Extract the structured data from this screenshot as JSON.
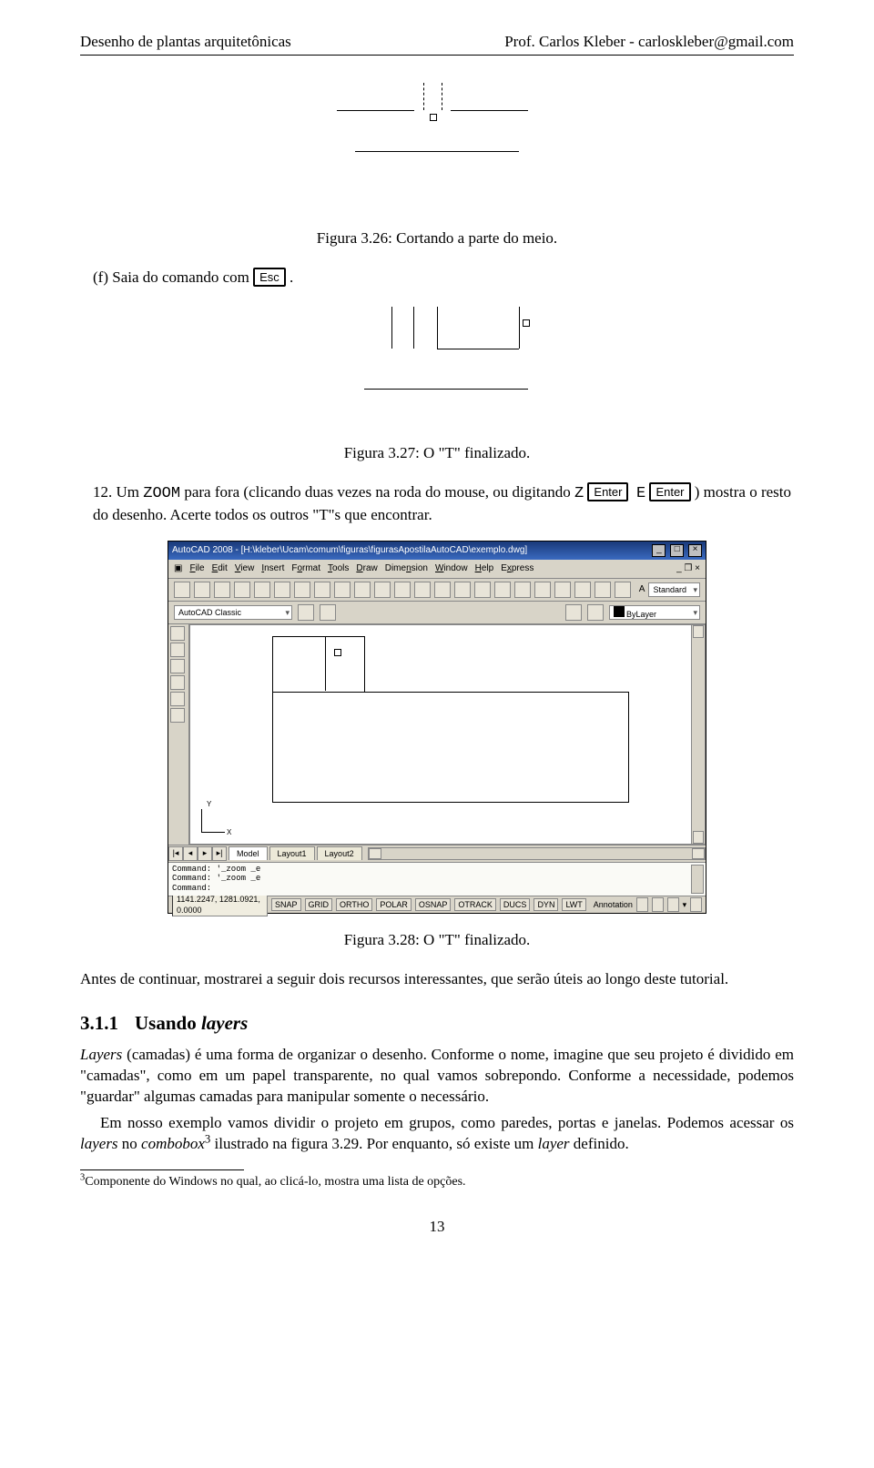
{
  "header": {
    "left": "Desenho de plantas arquitetônicas",
    "right": "Prof. Carlos Kleber - carloskleber@gmail.com"
  },
  "captions": {
    "fig326": "Figura 3.26: Cortando a parte do meio.",
    "fig327": "Figura 3.27: O \"T\" finalizado.",
    "fig328": "Figura 3.28: O \"T\" finalizado."
  },
  "list_f": {
    "label": "(f)",
    "text_before_key": "Saia do comando com ",
    "key": "Esc",
    "text_after_key": " ."
  },
  "list_12": {
    "label": "12.",
    "text_a": "Um ",
    "mono": "ZOOM",
    "text_b": " para fora (clicando duas vezes na roda do mouse, ou digitando ",
    "mono_z": "Z",
    "key1": "Enter",
    "mono_e": "E",
    "key2": "Enter",
    "text_c": " ) mostra o resto do desenho. Acerte todos os outros \"T\"s que encontrar."
  },
  "para_antes": "Antes de continuar, mostrarei a seguir dois recursos interessantes, que serão úteis ao longo deste tutorial.",
  "section": {
    "num": "3.1.1",
    "title": "Usando layers"
  },
  "para_layers_a": "Layers (camadas) é uma forma de organizar o desenho. Conforme o nome, imagine que seu projeto é dividido em \"camadas\", como em um papel transparente, no qual vamos sobrepondo. Conforme a necessidade, podemos \"guardar\" algumas camadas para manipular somente o necessário.",
  "para_layers_b_1": "Em nosso exemplo vamos dividir o projeto em grupos, como paredes, portas e janelas. Podemos acessar os ",
  "para_layers_b_2": " no ",
  "para_layers_b_3": " ilustrado na figura 3.29. Por enquanto, só existe um ",
  "para_layers_b_4": " definido.",
  "em_layers": "layers",
  "em_combobox": "combobox",
  "em_layer": "layer",
  "footnote_num": "3",
  "footnote_text": "Componente do Windows no qual, ao clicá-lo, mostra uma lista de opções.",
  "page_number": "13",
  "acad": {
    "title": "AutoCAD 2008 - [H:\\kleber\\Ucam\\comum\\figuras\\figurasApostilaAutoCAD\\exemplo.dwg]",
    "menus": [
      "File",
      "Edit",
      "View",
      "Insert",
      "Format",
      "Tools",
      "Draw",
      "Dimension",
      "Window",
      "Help",
      "Express"
    ],
    "combo_standard": "Standard",
    "workspace": "AutoCAD Classic",
    "bylayer": "ByLayer",
    "tabs_nav": [
      "|◂",
      "◂",
      "▸",
      "▸|"
    ],
    "tabs": [
      "Model",
      "Layout1",
      "Layout2"
    ],
    "cmd_lines": [
      "Command: '_zoom _e",
      "Command: '_zoom _e",
      "Command:"
    ],
    "coords": "1141.2247, 1281.0921, 0.0000",
    "toggles": [
      "SNAP",
      "GRID",
      "ORTHO",
      "POLAR",
      "OSNAP",
      "OTRACK",
      "DUCS",
      "DYN",
      "LWT"
    ],
    "annotation": "Annotation",
    "ucs_y": "Y",
    "ucs_x": "X"
  }
}
